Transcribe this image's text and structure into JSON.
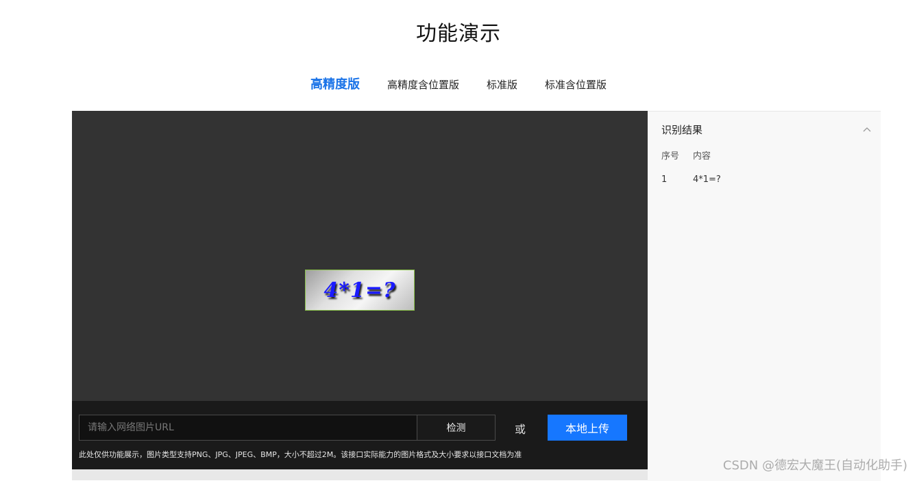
{
  "page": {
    "title": "功能演示"
  },
  "tabs": [
    {
      "label": "高精度版",
      "active": true
    },
    {
      "label": "高精度含位置版",
      "active": false
    },
    {
      "label": "标准版",
      "active": false
    },
    {
      "label": "标准含位置版",
      "active": false
    }
  ],
  "stage": {
    "captcha_text": "4*1=?"
  },
  "controls": {
    "url_placeholder": "请输入网络图片URL",
    "detect_label": "检测",
    "or_text": "或",
    "upload_label": "本地上传",
    "note": "此处仅供功能展示，图片类型支持PNG、JPG、JPEG、BMP，大小不超过2M。该接口实际能力的图片格式及大小要求以接口文档为准"
  },
  "result": {
    "title": "识别结果",
    "columns": [
      "序号",
      "内容"
    ],
    "rows": [
      {
        "index": "1",
        "content": "4*1=?"
      }
    ]
  },
  "watermark": "CSDN @德宏大魔王(自动化助手)",
  "colors": {
    "accent": "#1677ff",
    "active_tab": "#1a73e8",
    "stage_bg": "#333333",
    "controls_bg": "#1a1a1a",
    "panel_bg": "#f8f8f8"
  },
  "icons": {
    "collapse": "chevron-up-icon"
  }
}
